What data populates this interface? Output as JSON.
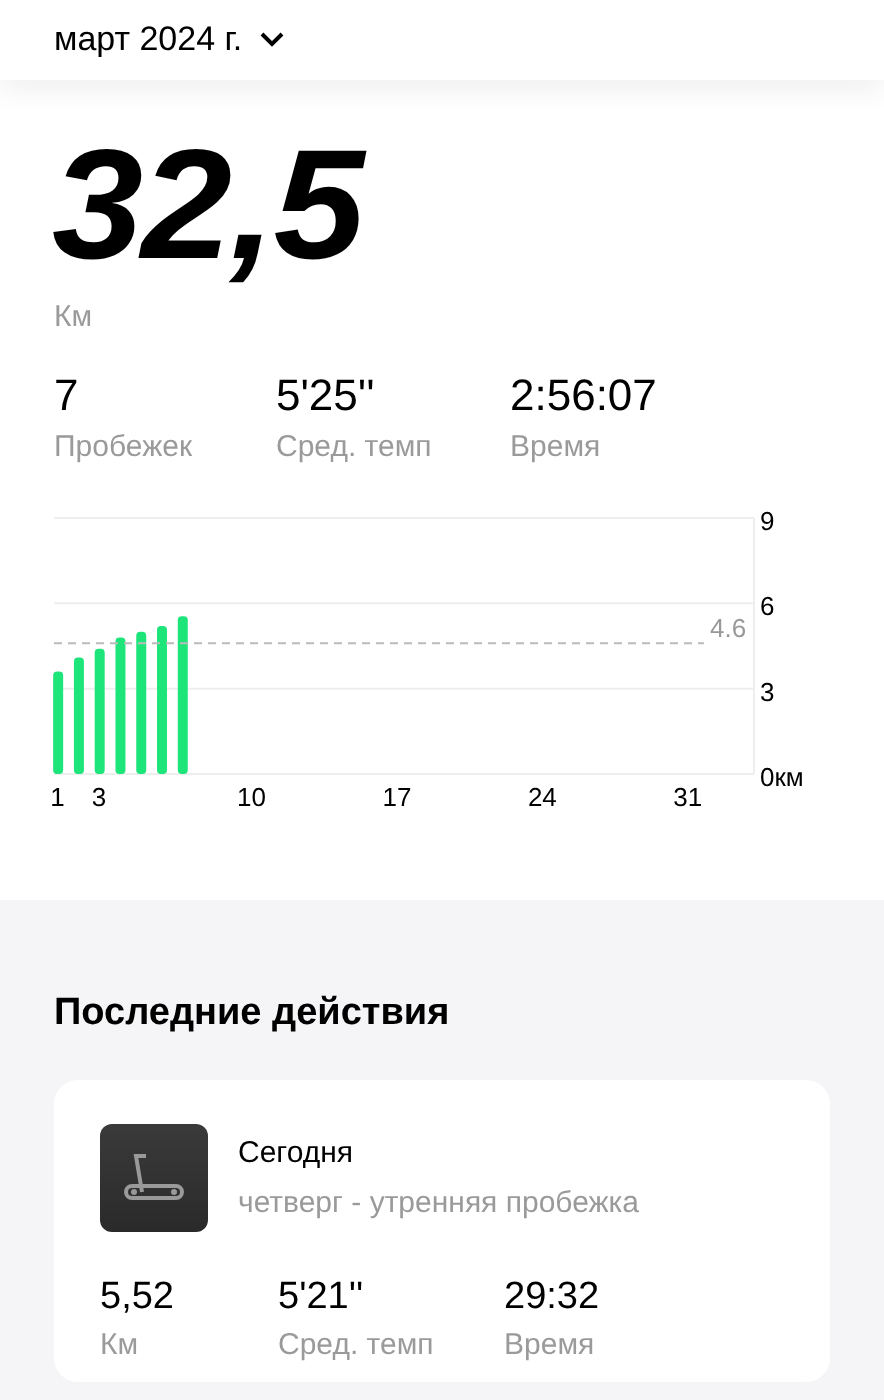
{
  "header": {
    "month": "март 2024 г."
  },
  "total": {
    "value": "32,5",
    "unit": "Км"
  },
  "stats": [
    {
      "value": "7",
      "label": "Пробежек"
    },
    {
      "value": "5'25''",
      "label": "Сред. темп"
    },
    {
      "value": "2:56:07",
      "label": "Время"
    }
  ],
  "chart_data": {
    "type": "bar",
    "x": [
      1,
      2,
      3,
      4,
      5,
      6,
      7
    ],
    "series": [
      {
        "color": "#1ee57a",
        "values": [
          3.6,
          4.1,
          4.4,
          4.8,
          5.0,
          5.2,
          5.55
        ]
      }
    ],
    "xlim": [
      0.8,
      34.5
    ],
    "ylim": [
      0,
      9
    ],
    "xticks": [
      1,
      3,
      10,
      17,
      24,
      31
    ],
    "yticks": [
      {
        "value": 0,
        "label": "0км"
      },
      3,
      6,
      9
    ],
    "ref_lines": [
      {
        "axis": "y",
        "value": 4.6,
        "label": "4.6"
      }
    ]
  },
  "recent": {
    "title": "Последние действия",
    "activities": [
      {
        "title": "Сегодня",
        "subtitle": "четверг - утренняя пробежка",
        "stats": [
          {
            "value": "5,52",
            "label": "Км"
          },
          {
            "value": "5'21''",
            "label": "Сред. темп"
          },
          {
            "value": "29:32",
            "label": "Время"
          }
        ]
      }
    ]
  }
}
